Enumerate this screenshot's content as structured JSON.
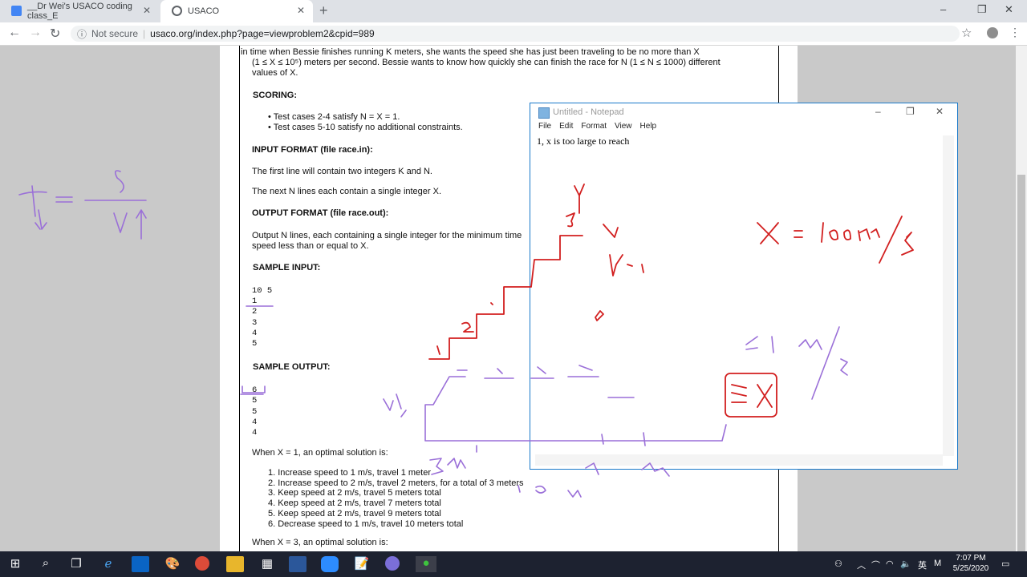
{
  "browser": {
    "tabs": [
      {
        "title": "__Dr Wei's USACO coding class_E",
        "active": false
      },
      {
        "title": "USACO",
        "active": true
      }
    ],
    "new_tab": "+",
    "nav": {
      "back": "←",
      "forward": "→",
      "reload": "↻"
    },
    "address": {
      "security": "Not secure",
      "url": "usaco.org/index.php?page=viewproblem2&cpid=989"
    },
    "window_controls": {
      "minimize": "–",
      "maximize": "❐",
      "close": "✕"
    }
  },
  "problem": {
    "intro_line1": "in time when Bessie finishes running K meters, she wants the speed she has just been traveling to be no more than X",
    "intro_line2": "(1 ≤ X ≤ 10⁵) meters per second. Bessie wants to know how quickly she can finish the race for N (1 ≤ N ≤ 1000) different",
    "intro_line3": "values of X.",
    "scoring_heading": "SCORING:",
    "scoring_items": [
      "Test cases 2-4 satisfy N = X = 1.",
      "Test cases 5-10 satisfy no additional constraints."
    ],
    "input_heading": "INPUT FORMAT (file race.in):",
    "input_line1": "The first line will contain two integers K and N.",
    "input_line2": "The next N lines each contain a single integer X.",
    "output_heading": "OUTPUT FORMAT (file race.out):",
    "output_line1": "Output N lines, each containing a single integer for the minimum time",
    "output_line2": "speed less than or equal to X.",
    "sample_input_heading": "SAMPLE INPUT:",
    "sample_input": [
      "10 5",
      "1",
      "2",
      "3",
      "4",
      "5"
    ],
    "sample_output_heading": "SAMPLE OUTPUT:",
    "sample_output": [
      "6",
      "5",
      "5",
      "4",
      "4"
    ],
    "when_x1": "When X = 1, an optimal solution is:",
    "steps": [
      "1. Increase speed to 1 m/s, travel 1 meter",
      "2. Increase speed to 2 m/s, travel 2 meters, for a total of 3 meters",
      "3. Keep speed at 2 m/s, travel 5 meters total",
      "4. Keep speed at 2 m/s, travel 7 meters total",
      "5. Keep speed at 2 m/s, travel 9 meters total",
      "6. Decrease speed to 1 m/s, travel 10 meters total"
    ],
    "when_x3": "When X = 3, an optimal solution is:"
  },
  "notepad": {
    "title": "Untitled - Notepad",
    "menu": [
      "File",
      "Edit",
      "Format",
      "View",
      "Help"
    ],
    "text": "1,   x is too large to reach"
  },
  "taskbar": {
    "tray_lang": "英",
    "time": "7:07 PM",
    "date": "5/25/2020"
  },
  "colors": {
    "ink_red": "#d21f1f",
    "ink_purple": "#9a6fd8",
    "taskbar": "#1d2230",
    "accent": "#1979ca"
  }
}
